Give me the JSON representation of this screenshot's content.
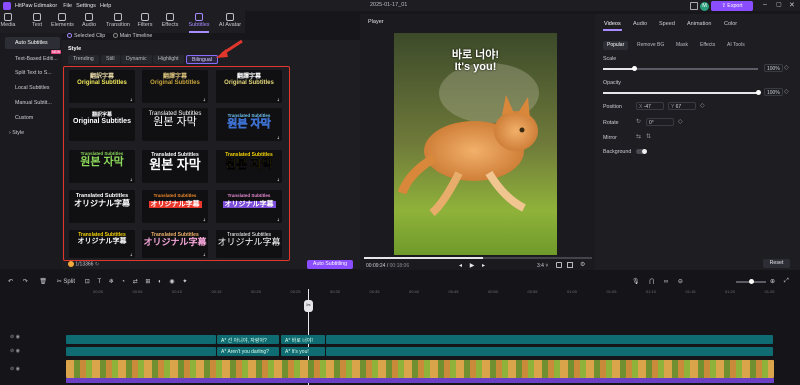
{
  "app": {
    "title": "HitPaw Edimakor",
    "menus": [
      "File",
      "Settings",
      "Help"
    ],
    "project_name": "2025-01-17_01",
    "export_label": "Export",
    "avatar_letter": "M"
  },
  "toolbar": {
    "items": [
      "Media",
      "Text",
      "Elements",
      "Audio",
      "Transition",
      "Filters",
      "Effects",
      "Subtitles",
      "AI Avatar"
    ],
    "active": "Subtitles"
  },
  "scope": {
    "selected_clip": "Selected Clip",
    "main_timeline": "Main Timeline"
  },
  "sidebar": {
    "items": [
      "Auto Subtitles",
      "Text-Based Editi...",
      "Split Text to S...",
      "Local Subtitles",
      "Manual Subtit...",
      "Custom",
      "Style"
    ],
    "new_badge": "NEW"
  },
  "style_panel": {
    "heading": "Style",
    "filters": [
      "Trending",
      "Still",
      "Dynamic",
      "Highlight",
      "Bilingual"
    ],
    "selected_filter": "Bilingual",
    "tiles": [
      {
        "top": "翻訳字幕",
        "bottom": "Original Subtitles"
      },
      {
        "top": "翻譯字幕",
        "bottom": "Original Subtitles"
      },
      {
        "top": "翻譯字幕",
        "bottom": "Original Subtitles"
      },
      {
        "top": "翻訳字幕",
        "bottom": "Original Subtitles"
      },
      {
        "top": "Translated Subtitles",
        "bottom": "원본 자막"
      },
      {
        "top": "Translated Subtitles",
        "bottom": "원본 자막"
      },
      {
        "top": "Translated Subtitles",
        "bottom": "원본 자막"
      },
      {
        "top": "Translated Subtitles",
        "bottom": "원본 자막"
      },
      {
        "top": "Translated Subtitles",
        "bottom": "원본 자막"
      },
      {
        "top": "Translated Subtitles",
        "bottom": "オリジナル字幕"
      },
      {
        "top": "Translated Subtitles",
        "bottom": "オリジナル字幕"
      },
      {
        "top": "Translated Subtitles",
        "bottom": "オリジナル字幕"
      },
      {
        "top": "Translated Subtitles",
        "bottom": "オリジナル字幕"
      },
      {
        "top": "Translated Subtitles",
        "bottom": "オリジナル字幕"
      },
      {
        "top": "Translated Subtitles",
        "bottom": "オリジナル字幕"
      }
    ],
    "credits": "1/13366",
    "auto_subtitling_label": "Auto Subtitling"
  },
  "player": {
    "label": "Player",
    "subtitle_line1": "바로 너야!",
    "subtitle_line2": "It's you!",
    "current_time": "00:09:24",
    "total_time": "00:18:06",
    "aspect": "3:4",
    "separator": "/"
  },
  "right_panel": {
    "tabs": [
      "Videos",
      "Audio",
      "Speed",
      "Animation",
      "Color"
    ],
    "active_tab": "Videos",
    "subtabs": [
      "Popular",
      "Remove BG",
      "Mask",
      "Effects",
      "AI Tools"
    ],
    "active_subtab": "Popular",
    "scale_label": "Scale",
    "scale_value": "100%",
    "scale_level": 0.2,
    "opacity_label": "Opacity",
    "opacity_value": "100%",
    "opacity_level": 1.0,
    "position_label": "Position",
    "x_label": "X",
    "x_value": "-47",
    "y_label": "Y",
    "y_value": "67",
    "rotate_label": "Rotate",
    "rotate_value": "0°",
    "mirror_label": "Mirror",
    "background_label": "Background",
    "reset_label": "Reset"
  },
  "timeline": {
    "split_label": "Split",
    "ruler": [
      "00:00",
      "00:05",
      "00:10",
      "00:15",
      "00:20",
      "00:25",
      "00:30",
      "00:35",
      "00:40",
      "00:45",
      "00:50",
      "00:55",
      "01:00",
      "01:05",
      "01:10",
      "01:15",
      "01:20",
      "01:25"
    ],
    "track1_clips": [
      "A* 선 아니야, 자랑아?",
      "A* 바로 너야!"
    ],
    "track2_clips": [
      "A* Aren't you darling?",
      "A* It's you!"
    ]
  },
  "colors": {
    "accent": "#8a4dff",
    "highlight_box": "#e0362c",
    "track": "#0f6c73"
  },
  "icons": [
    "logo-icon",
    "media-icon",
    "text-icon",
    "elements-icon",
    "audio-icon",
    "transition-icon",
    "filters-icon",
    "effects-icon",
    "subtitles-icon",
    "ai-avatar-icon",
    "undo-icon",
    "redo-icon",
    "play-icon",
    "scissors-icon",
    "arrow-annotation-icon"
  ]
}
